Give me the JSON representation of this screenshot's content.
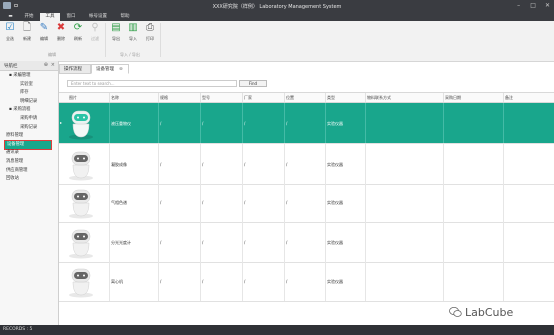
{
  "window": {
    "title": "XXX研究院（样例）  Laboratory Management System"
  },
  "menu": [
    {
      "label": "开始",
      "active": false
    },
    {
      "label": "工具",
      "active": true
    },
    {
      "label": "窗口",
      "active": false
    },
    {
      "label": "帐号设置",
      "active": false
    },
    {
      "label": "帮助",
      "active": false
    }
  ],
  "ribbon": {
    "buttons": [
      {
        "label": "全选",
        "icon": "select-all-icon",
        "glyph": "☑",
        "color": "#1e7fc6"
      },
      {
        "label": "新建",
        "icon": "new-doc-icon",
        "glyph": "🗋",
        "color": "#666"
      },
      {
        "label": "编辑",
        "icon": "edit-icon",
        "glyph": "✎",
        "color": "#3b7fc4"
      },
      {
        "label": "删除",
        "icon": "delete-icon",
        "glyph": "✖",
        "color": "#d93a3a"
      },
      {
        "label": "刷新",
        "icon": "refresh-icon",
        "glyph": "⟳",
        "color": "#2e9e46"
      },
      {
        "label": "过滤",
        "icon": "filter-icon",
        "glyph": "⚲",
        "color": "#888"
      },
      {
        "label": "导出",
        "icon": "export-icon",
        "glyph": "▤",
        "color": "#2e9e46"
      },
      {
        "label": "导入",
        "icon": "import-icon",
        "glyph": "▥",
        "color": "#2e9e46"
      },
      {
        "label": "打印",
        "icon": "print-icon",
        "glyph": "⎙",
        "color": "#555"
      }
    ],
    "group_labels": [
      "编辑",
      "导入 / 导出"
    ]
  },
  "sidepanel": {
    "title": "导航栏",
    "tree": [
      {
        "label": "▪ 采编管理",
        "level": 1
      },
      {
        "label": "实验室",
        "level": 2
      },
      {
        "label": "库存",
        "level": 2
      },
      {
        "label": "明细记录",
        "level": 2
      },
      {
        "label": "▪ 采购流程",
        "level": 1
      },
      {
        "label": "采购申请",
        "level": 2
      },
      {
        "label": "采购记录",
        "level": 2
      },
      {
        "label": "原料管理",
        "level": 0
      },
      {
        "label": "设备管理",
        "level": 0,
        "selected": true
      },
      {
        "label": "通讯录",
        "level": 0
      },
      {
        "label": "消息管理",
        "level": 0
      },
      {
        "label": "供应商管理",
        "level": 0
      },
      {
        "label": "回收站",
        "level": 0
      }
    ]
  },
  "tabs": [
    {
      "label": "操作流程",
      "active": false
    },
    {
      "label": "设备管理",
      "active": true
    }
  ],
  "search": {
    "placeholder": "Enter text to search...",
    "find_label": "Find"
  },
  "grid": {
    "columns": [
      "图片",
      "名称",
      "规格",
      "型号",
      "厂家",
      "位置",
      "类型",
      "物料联系方式",
      "采购日期",
      "备注"
    ],
    "rows": [
      {
        "name": "液压重物仪",
        "spec": "/",
        "model": "/",
        "maker": "/",
        "location": "/",
        "type": "实验仪器",
        "selected": true
      },
      {
        "name": "凝胶成像",
        "spec": "/",
        "model": "/",
        "maker": "/",
        "location": "/",
        "type": "实验仪器",
        "selected": false
      },
      {
        "name": "气相色谱",
        "spec": "/",
        "model": "/",
        "maker": "/",
        "location": "/",
        "type": "实验仪器",
        "selected": false
      },
      {
        "name": "分光光度计",
        "spec": "/",
        "model": "/",
        "maker": "/",
        "location": "/",
        "type": "实验仪器",
        "selected": false
      },
      {
        "name": "离心机",
        "spec": "/",
        "model": "/",
        "maker": "/",
        "location": "/",
        "type": "实验仪器",
        "selected": false
      }
    ]
  },
  "statusbar": {
    "text": "RECORDS : 5"
  },
  "watermark": {
    "text": "LabCube"
  },
  "colors": {
    "accent": "#19a68c",
    "titlebar": "#3a3c41",
    "selection_outline": "#e03b3b"
  }
}
